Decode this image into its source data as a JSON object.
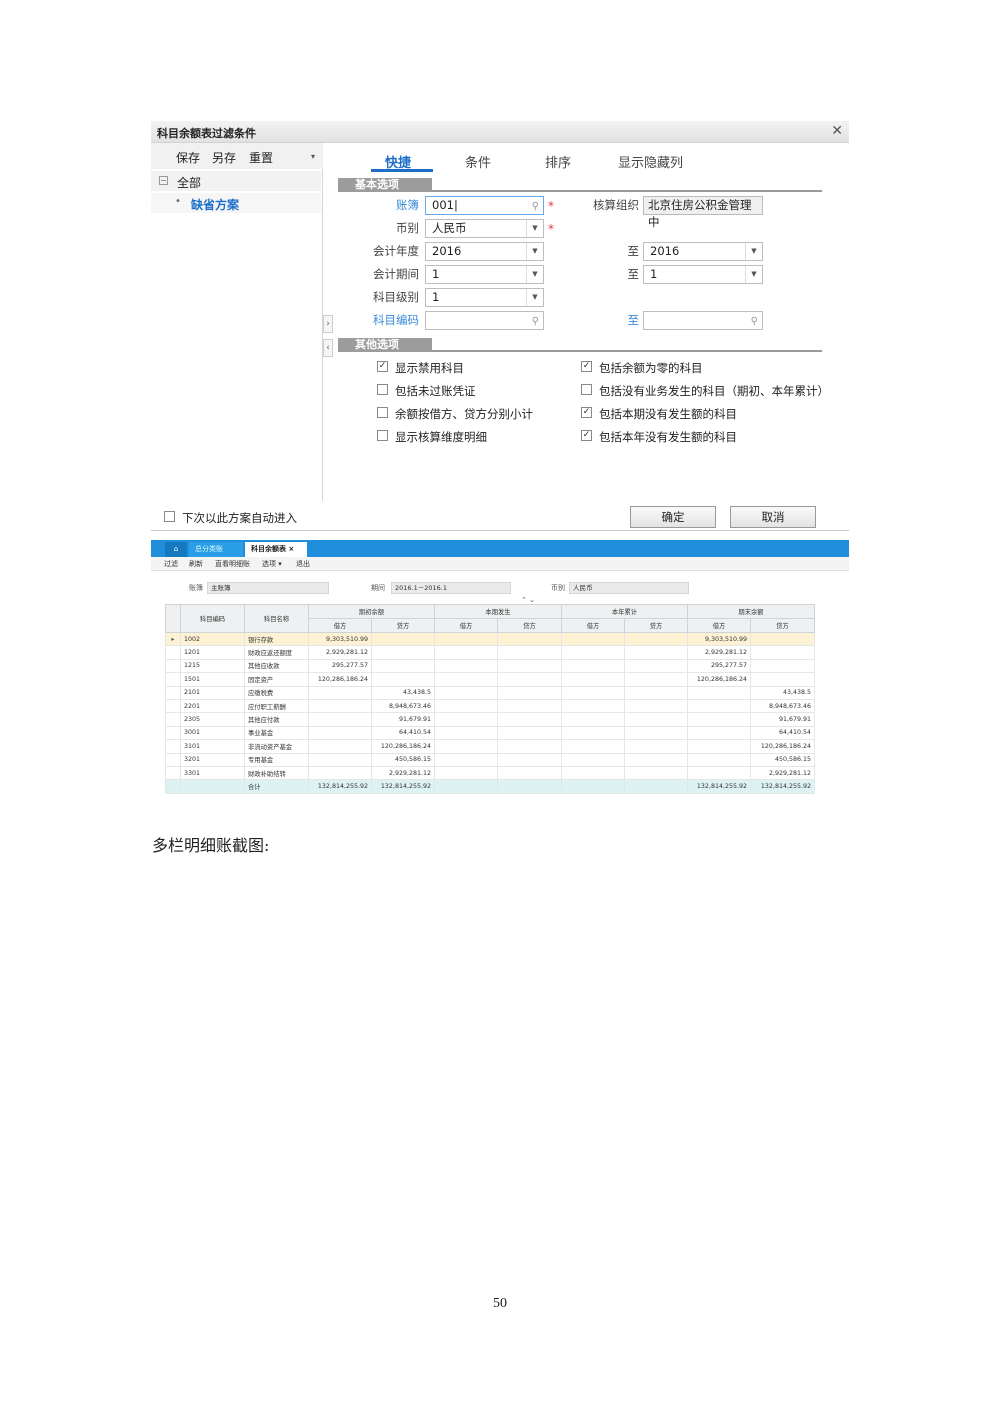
{
  "dialog": {
    "title": "科目余额表过滤条件",
    "close_glyph": "✕",
    "toolbar": {
      "save": "保存",
      "save_as": "另存",
      "reset": "重置"
    },
    "tree": {
      "all": "全部",
      "default_scheme": "缺省方案"
    },
    "tabs": [
      "快捷",
      "条件",
      "排序",
      "显示隐藏列"
    ],
    "sections": {
      "basic": "基本选项",
      "other": "其他选项"
    },
    "fields": {
      "ledger_label": "账簿",
      "ledger_value": "001|",
      "org_label": "核算组织",
      "org_value": "北京住房公积金管理中",
      "currency_label": "币别",
      "currency_value": "人民币",
      "year_label": "会计年度",
      "year_from": "2016",
      "year_to_label": "至",
      "year_to": "2016",
      "period_label": "会计期间",
      "period_from": "1",
      "period_to_label": "至",
      "period_to": "1",
      "level_label": "科目级别",
      "level_value": "1",
      "code_label": "科目编码",
      "code_to_label": "至"
    },
    "checkboxes": [
      {
        "label": "显示禁用科目",
        "checked": true
      },
      {
        "label": "包括余额为零的科目",
        "checked": true
      },
      {
        "label": "包括未过账凭证",
        "checked": false
      },
      {
        "label": "包括没有业务发生的科目（期初、本年累计）",
        "checked": false
      },
      {
        "label": "余额按借方、贷方分别小计",
        "checked": false
      },
      {
        "label": "包括本期没有发生额的科目",
        "checked": true
      },
      {
        "label": "显示核算维度明细",
        "checked": false
      },
      {
        "label": "包括本年没有发生额的科目",
        "checked": true
      }
    ],
    "auto_enter_label": "下次以此方案自动进入",
    "ok": "确定",
    "cancel": "取消"
  },
  "report": {
    "tabs": {
      "home": "⌂",
      "t1": "总分类账",
      "t2": "科目余额表 ×"
    },
    "toolbar": [
      "过滤",
      "刷新",
      "直看明细账",
      "选项 ▾",
      "退出"
    ],
    "filter": {
      "ledger_label": "账簿",
      "ledger_value": "主账簿",
      "period_label": "期间",
      "period_value": "2016.1－2016.1",
      "currency_label": "币别",
      "currency_value": "人民币"
    },
    "updown": "⌃ ⌄",
    "headers": {
      "code": "科目编码",
      "name": "科目名称",
      "groups": [
        "期初余额",
        "本期发生",
        "本年累计",
        "期末余额"
      ],
      "debit": "借方",
      "credit": "贷方"
    },
    "rows": [
      {
        "mark": "▸",
        "code": "1002",
        "name": "银行存款",
        "open_d": "9,303,510.99",
        "open_c": "",
        "end_d": "9,303,510.99",
        "end_c": ""
      },
      {
        "mark": "",
        "code": "1201",
        "name": "财政应返还额度",
        "open_d": "2,929,281.12",
        "open_c": "",
        "end_d": "2,929,281.12",
        "end_c": ""
      },
      {
        "mark": "",
        "code": "1215",
        "name": "其他应收款",
        "open_d": "295,277.57",
        "open_c": "",
        "end_d": "295,277.57",
        "end_c": ""
      },
      {
        "mark": "",
        "code": "1501",
        "name": "固定资产",
        "open_d": "120,286,186.24",
        "open_c": "",
        "end_d": "120,286,186.24",
        "end_c": ""
      },
      {
        "mark": "",
        "code": "2101",
        "name": "应缴税费",
        "open_d": "",
        "open_c": "43,438.5",
        "end_d": "",
        "end_c": "43,438.5"
      },
      {
        "mark": "",
        "code": "2201",
        "name": "应付职工薪酬",
        "open_d": "",
        "open_c": "8,948,673.46",
        "end_d": "",
        "end_c": "8,948,673.46"
      },
      {
        "mark": "",
        "code": "2305",
        "name": "其他应付款",
        "open_d": "",
        "open_c": "91,679.91",
        "end_d": "",
        "end_c": "91,679.91"
      },
      {
        "mark": "",
        "code": "3001",
        "name": "事业基金",
        "open_d": "",
        "open_c": "64,410.54",
        "end_d": "",
        "end_c": "64,410.54"
      },
      {
        "mark": "",
        "code": "3101",
        "name": "非流动资产基金",
        "open_d": "",
        "open_c": "120,286,186.24",
        "end_d": "",
        "end_c": "120,286,186.24"
      },
      {
        "mark": "",
        "code": "3201",
        "name": "专用基金",
        "open_d": "",
        "open_c": "450,586.15",
        "end_d": "",
        "end_c": "450,586.15"
      },
      {
        "mark": "",
        "code": "3301",
        "name": "财政补助结转",
        "open_d": "",
        "open_c": "2,929,281.12",
        "end_d": "",
        "end_c": "2,929,281.12"
      }
    ],
    "total": {
      "name": "合计",
      "open_d": "132,814,255.92",
      "open_c": "132,814,255.92",
      "end_d": "132,814,255.92",
      "end_c": "132,814,255.92"
    }
  },
  "caption": "多栏明细账截图:",
  "page_number": "50"
}
